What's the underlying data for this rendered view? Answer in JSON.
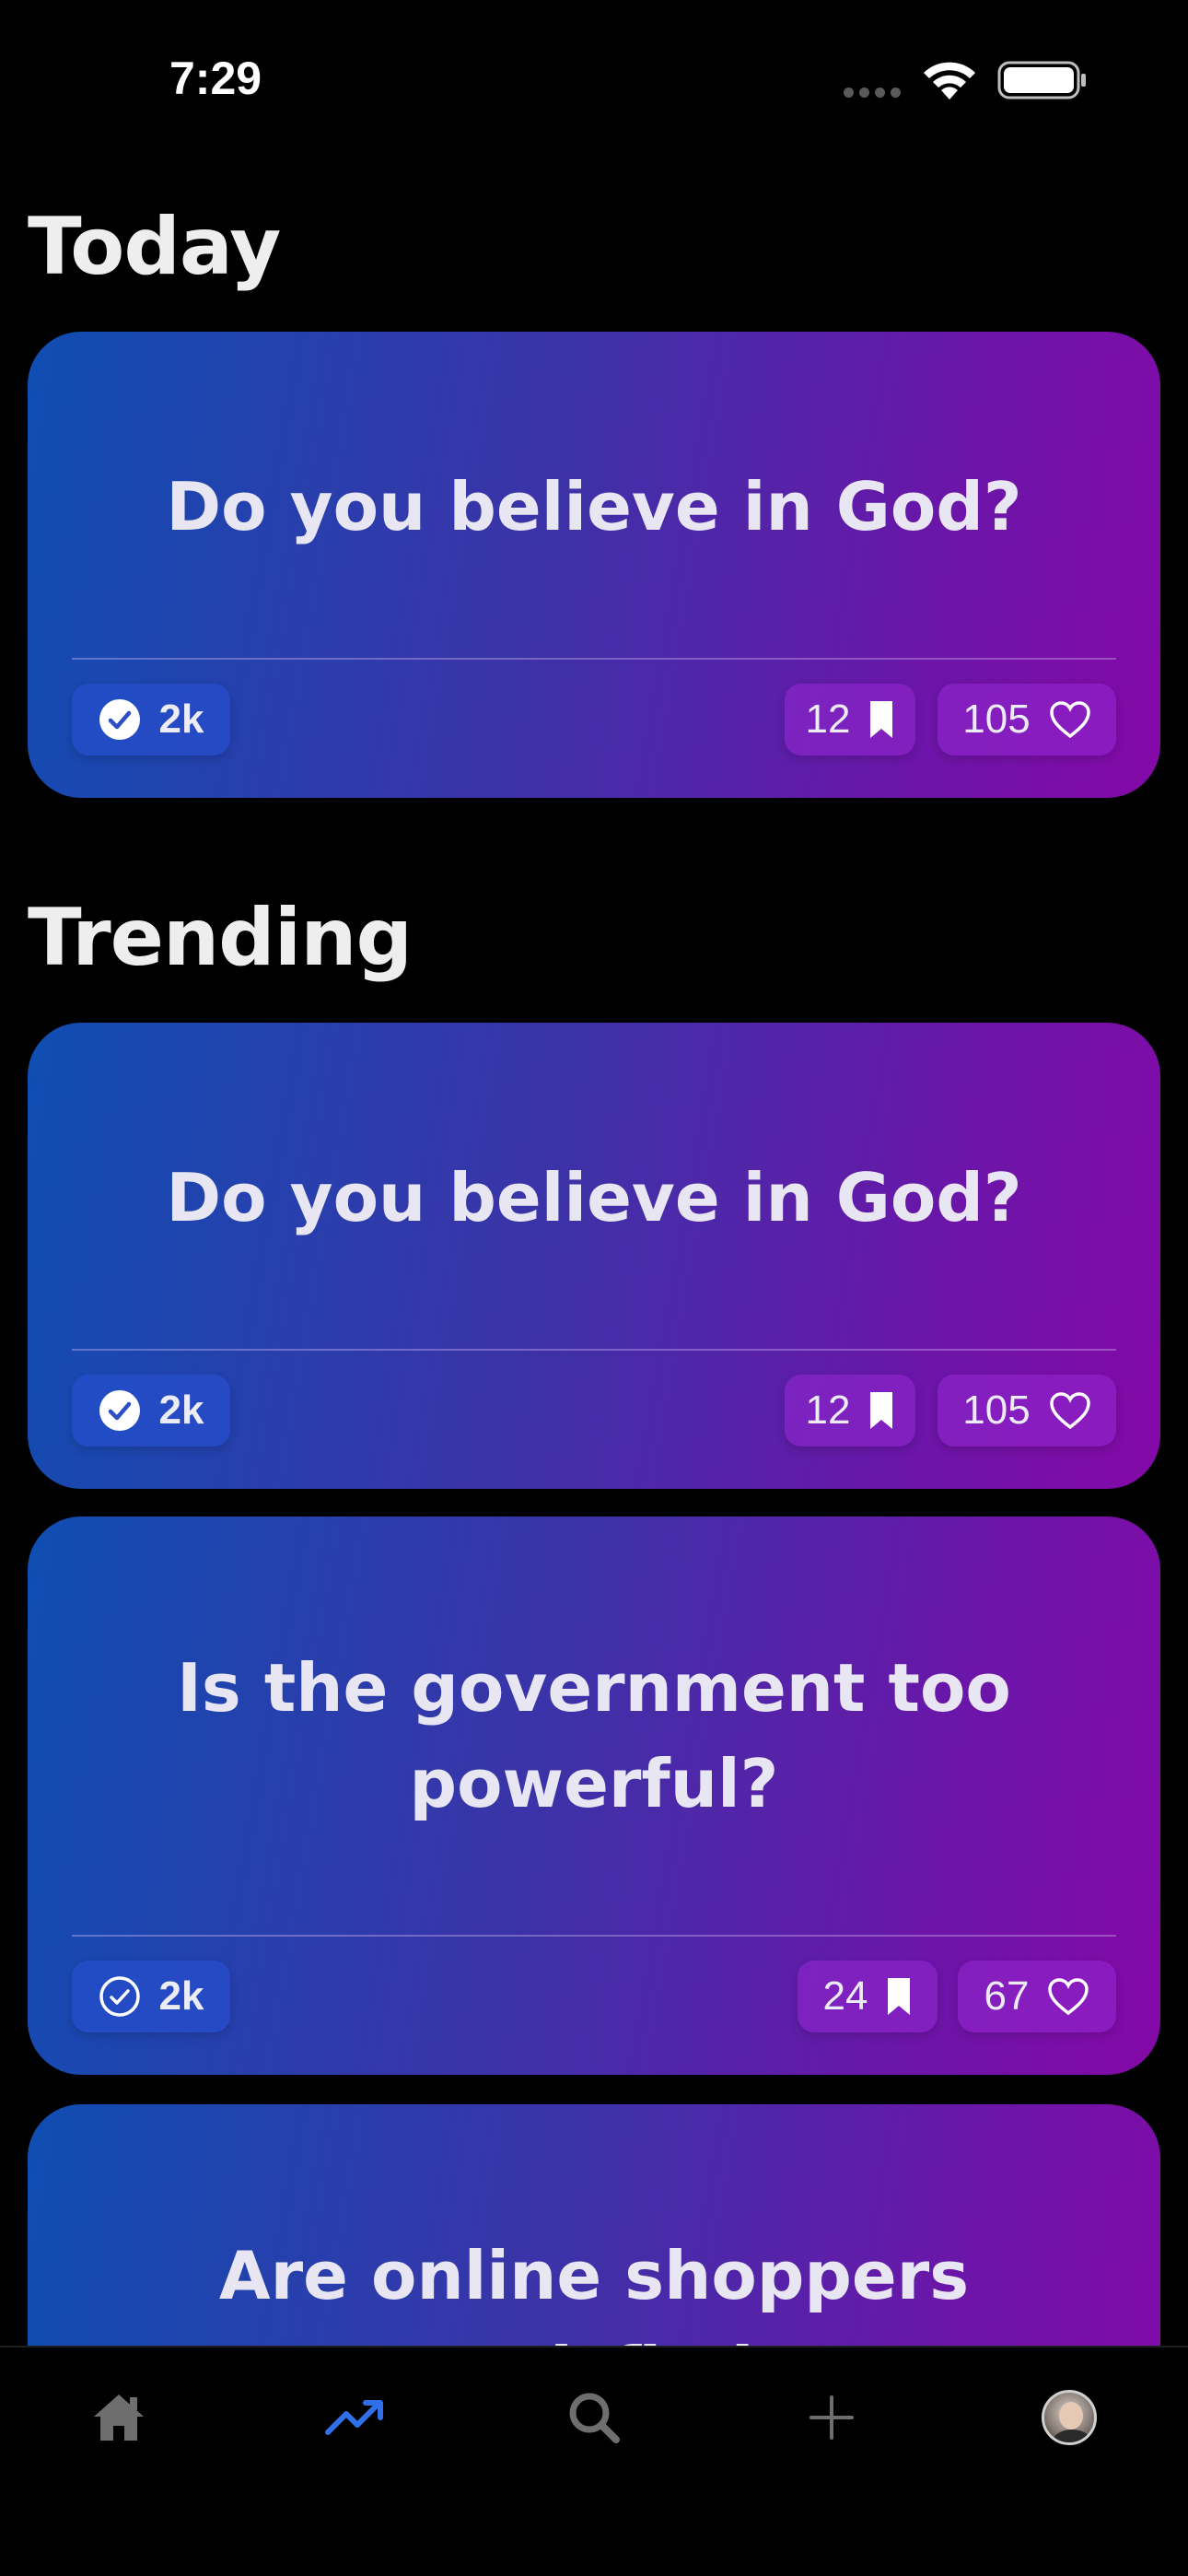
{
  "status_bar": {
    "time": "7:29"
  },
  "sections": {
    "today": {
      "title": "Today"
    },
    "trending": {
      "title": "Trending"
    }
  },
  "today_card": {
    "question": "Do you believe in God?",
    "answers": "2k",
    "saves": "12",
    "likes": "105",
    "answered": true
  },
  "trending_cards": [
    {
      "question": "Do you believe in God?",
      "answers": "2k",
      "saves": "12",
      "likes": "105",
      "answered": true
    },
    {
      "question": "Is the government too powerful?",
      "answers": "2k",
      "saves": "24",
      "likes": "67",
      "answered": false
    },
    {
      "question": "Are online shoppers satisfied"
    }
  ],
  "tab_bar": {
    "tabs": [
      {
        "name": "home",
        "icon": "home-icon",
        "active": false
      },
      {
        "name": "trending",
        "icon": "trending-icon",
        "active": true
      },
      {
        "name": "search",
        "icon": "search-icon",
        "active": false
      },
      {
        "name": "create",
        "icon": "plus-icon",
        "active": false
      },
      {
        "name": "profile",
        "icon": "avatar",
        "active": false
      }
    ]
  },
  "colors": {
    "background": "#000000",
    "card_gradient_start": "#0f4eb2",
    "card_gradient_end": "#8409a6",
    "active_tab": "#2f6fe8",
    "inactive_tab": "#6e6e6e"
  }
}
